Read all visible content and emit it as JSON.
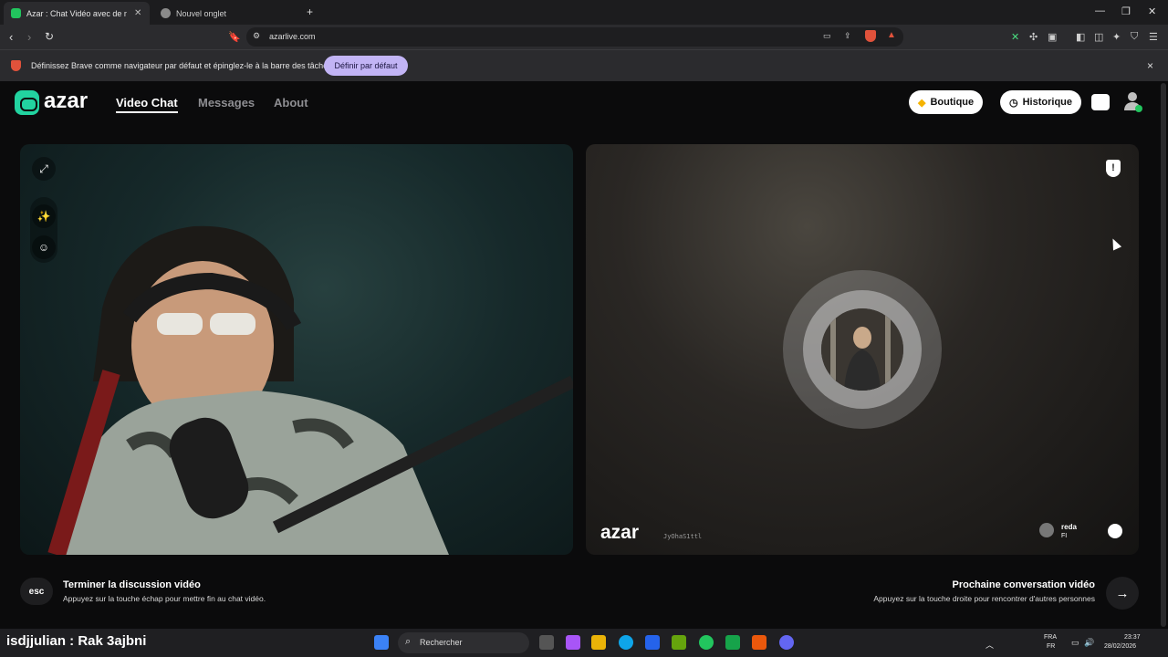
{
  "browser": {
    "tabs": [
      {
        "label": "Azar : Chat Vidéo avec de no",
        "active": true
      },
      {
        "label": "Nouvel onglet",
        "active": false
      }
    ],
    "new_tab_symbol": "+",
    "url": "azarlive.com",
    "infobar": {
      "text": "Définissez Brave comme navigateur par défaut et épinglez-le à la barre des tâches",
      "button": "Définir par défaut",
      "close": "×"
    }
  },
  "header": {
    "logo": "azar",
    "nav": [
      {
        "label": "Video Chat",
        "active": true
      },
      {
        "label": "Messages",
        "active": false
      },
      {
        "label": "About",
        "active": false
      }
    ],
    "shop_button": "Boutique",
    "history_button": "Historique"
  },
  "remote": {
    "watermark": "azar",
    "watermark_id": "JyOhaS1ttl",
    "peer_name": "reda",
    "peer_country": "FI"
  },
  "footer": {
    "esc_key": "esc",
    "end_title": "Terminer la discussion vidéo",
    "end_desc": "Appuyez sur la touche échap pour mettre fin au chat vidéo.",
    "next_title": "Prochaine conversation vidéo",
    "next_desc": "Appuyez sur la touche droite pour rencontrer d'autres personnes",
    "next_arrow": "→"
  },
  "taskbar": {
    "overlay": "isdjjulian : Rak 3ajbni",
    "search": "Rechercher",
    "lang_top": "FRA",
    "lang_bottom": "FR",
    "time": "23:37",
    "date": "28/02/2026"
  },
  "colors": {
    "accent": "#22d3a0",
    "infobar_button": "#c2b4f5"
  }
}
